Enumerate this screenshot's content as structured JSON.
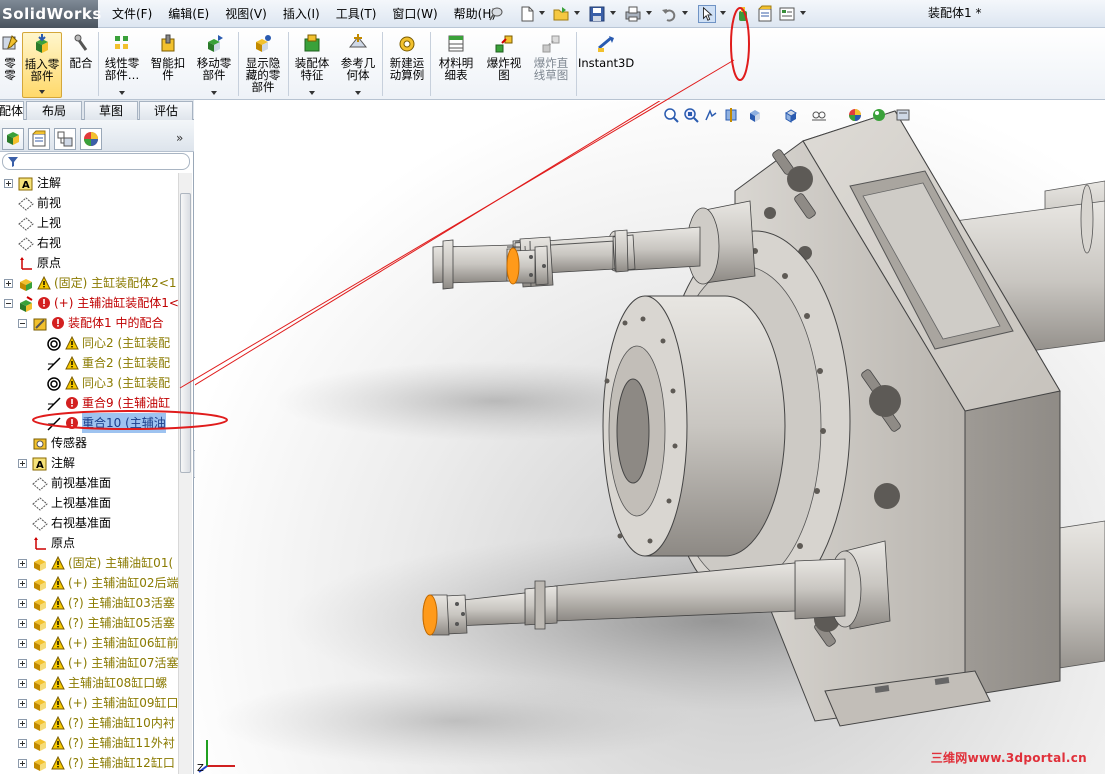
{
  "app": {
    "logo": "SolidWorks",
    "document_title": "装配体1 *"
  },
  "menu": [
    "文件(F)",
    "编辑(E)",
    "视图(V)",
    "插入(I)",
    "工具(T)",
    "窗口(W)",
    "帮助(H)"
  ],
  "commands": [
    {
      "label": "零\n零",
      "icon": "edit-component-icon"
    },
    {
      "label": "插入零\n部件",
      "icon": "insert-component-icon",
      "active": true
    },
    {
      "label": "配合",
      "icon": "mate-icon"
    },
    {
      "label": "线性零\n部件…",
      "icon": "linear-pattern-icon"
    },
    {
      "label": "智能扣\n件",
      "icon": "smart-fastener-icon"
    },
    {
      "label": "移动零\n部件",
      "icon": "move-component-icon"
    },
    {
      "label": "显示隐\n藏的零\n部件",
      "icon": "show-hidden-icon"
    },
    {
      "label": "装配体\n特征",
      "icon": "assembly-feature-icon"
    },
    {
      "label": "参考几\n何体",
      "icon": "reference-geometry-icon"
    },
    {
      "label": "新建运\n动算例",
      "icon": "motion-study-icon"
    },
    {
      "label": "材料明\n细表",
      "icon": "bom-icon"
    },
    {
      "label": "爆炸视\n图",
      "icon": "exploded-view-icon"
    },
    {
      "label": "爆炸直\n线草图",
      "icon": "explode-line-icon",
      "disabled": true
    },
    {
      "label": "Instant3D",
      "icon": "instant3d-icon"
    }
  ],
  "tabs": [
    {
      "label": "配体",
      "active": true
    },
    {
      "label": "布局"
    },
    {
      "label": "草图"
    },
    {
      "label": "评估"
    }
  ],
  "tree": [
    {
      "label": "注解",
      "icon": "annotation-icon",
      "expander": "plus",
      "level": 0,
      "color": "black"
    },
    {
      "label": "前视",
      "icon": "plane-icon",
      "level": 0,
      "color": "black"
    },
    {
      "label": "上视",
      "icon": "plane-icon",
      "level": 0,
      "color": "black"
    },
    {
      "label": "右视",
      "icon": "plane-icon",
      "level": 0,
      "color": "black"
    },
    {
      "label": "原点",
      "icon": "origin-icon",
      "level": 0,
      "color": "black"
    },
    {
      "label": "(固定) 主缸装配体2<1",
      "icon": "subassembly-icon",
      "status": "warning",
      "expander": "plus",
      "level": 0,
      "color": "olive"
    },
    {
      "label": "(+) 主辅油缸装配体1<",
      "icon": "subassembly-edit-icon",
      "status": "error",
      "expander": "minus",
      "level": 0,
      "color": "red"
    },
    {
      "label": "装配体1 中的配合",
      "icon": "mates-folder-icon",
      "status": "error",
      "expander": "minus",
      "level": 1,
      "color": "red"
    },
    {
      "label": "同心2 (主缸装配",
      "icon": "concentric-icon",
      "status": "warning",
      "level": 2,
      "color": "olive"
    },
    {
      "label": "重合2 (主缸装配",
      "icon": "coincident-icon",
      "status": "warning",
      "level": 2,
      "color": "olive"
    },
    {
      "label": "同心3 (主缸装配",
      "icon": "concentric-icon",
      "status": "warning",
      "level": 2,
      "color": "olive"
    },
    {
      "label": "重合9 (主辅油缸",
      "icon": "coincident-icon",
      "status": "error",
      "level": 2,
      "color": "red"
    },
    {
      "label": "重合10 (主辅油",
      "icon": "coincident-icon",
      "status": "error",
      "level": 2,
      "color": "blue",
      "selected": true
    },
    {
      "label": "传感器",
      "icon": "sensor-icon",
      "level": 1,
      "color": "black"
    },
    {
      "label": "注解",
      "icon": "annotation-icon",
      "expander": "plus",
      "level": 1,
      "color": "black"
    },
    {
      "label": "前视基准面",
      "icon": "plane-icon",
      "level": 1,
      "color": "black"
    },
    {
      "label": "上视基准面",
      "icon": "plane-icon",
      "level": 1,
      "color": "black"
    },
    {
      "label": "右视基准面",
      "icon": "plane-icon",
      "level": 1,
      "color": "black"
    },
    {
      "label": "原点",
      "icon": "origin-icon",
      "level": 1,
      "color": "black"
    },
    {
      "label": "(固定) 主辅油缸01(",
      "icon": "part-icon",
      "status": "warning",
      "expander": "plus",
      "level": 1,
      "color": "olive"
    },
    {
      "label": "(+) 主辅油缸02后端",
      "icon": "part-icon",
      "status": "warning",
      "expander": "plus",
      "level": 1,
      "color": "olive"
    },
    {
      "label": "(?) 主辅油缸03活塞",
      "icon": "part-icon",
      "status": "warning",
      "expander": "plus",
      "level": 1,
      "color": "olive"
    },
    {
      "label": "(?) 主辅油缸05活塞",
      "icon": "part-icon",
      "status": "warning",
      "expander": "plus",
      "level": 1,
      "color": "olive"
    },
    {
      "label": "(+) 主辅油缸06缸前",
      "icon": "part-icon",
      "status": "warning",
      "expander": "plus",
      "level": 1,
      "color": "olive"
    },
    {
      "label": "(+) 主辅油缸07活塞",
      "icon": "part-icon",
      "status": "warning",
      "expander": "plus",
      "level": 1,
      "color": "olive"
    },
    {
      "label": "主辅油缸08缸口螺",
      "icon": "part-icon",
      "status": "warning",
      "expander": "plus",
      "level": 1,
      "color": "olive"
    },
    {
      "label": "(+) 主辅油缸09缸口",
      "icon": "part-icon",
      "status": "warning",
      "expander": "plus",
      "level": 1,
      "color": "olive"
    },
    {
      "label": "(?) 主辅油缸10内衬",
      "icon": "part-icon",
      "status": "warning",
      "expander": "plus",
      "level": 1,
      "color": "olive"
    },
    {
      "label": "(?) 主辅油缸11外衬",
      "icon": "part-icon",
      "status": "warning",
      "expander": "plus",
      "level": 1,
      "color": "olive"
    },
    {
      "label": "(?) 主辅油缸12缸口",
      "icon": "part-icon",
      "status": "warning",
      "expander": "plus",
      "level": 1,
      "color": "olive"
    }
  ],
  "viewport": {
    "watermark": "三维网www.3dportal.cn",
    "triad_label": "Z"
  }
}
